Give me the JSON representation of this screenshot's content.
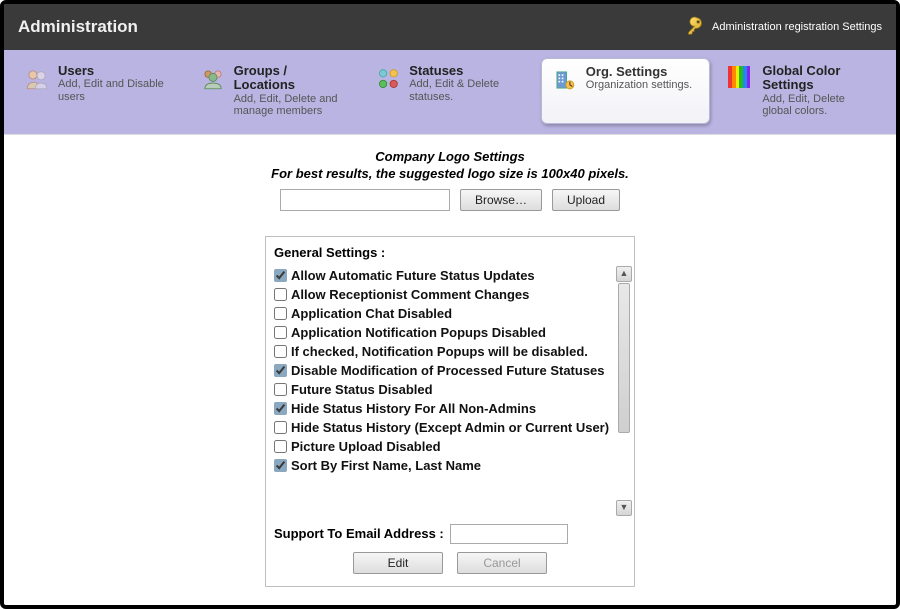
{
  "header": {
    "title": "Administration",
    "right_text": "Administration registration Settings",
    "icon": "key-icon"
  },
  "ribbon": {
    "items": [
      {
        "id": "users",
        "title": "Users",
        "subtitle": "Add, Edit and Disable users"
      },
      {
        "id": "groups",
        "title": "Groups / Locations",
        "subtitle": "Add, Edit, Delete and manage members"
      },
      {
        "id": "statuses",
        "title": "Statuses",
        "subtitle": "Add, Edit & Delete statuses."
      },
      {
        "id": "org",
        "title": "Org. Settings",
        "subtitle": "Organization settings.",
        "active": true
      },
      {
        "id": "colors",
        "title": "Global Color Settings",
        "subtitle": "Add, Edit, Delete global colors."
      }
    ]
  },
  "logo_section": {
    "heading": "Company Logo Settings",
    "subheading": "For best results, the suggested logo size is 100x40 pixels.",
    "browse_label": "Browse…",
    "upload_label": "Upload"
  },
  "panel": {
    "title": "General Settings :",
    "support_label": "Support To Email Address :",
    "support_value": "",
    "edit_label": "Edit",
    "cancel_label": "Cancel",
    "options": [
      {
        "label": "Allow Automatic Future Status Updates",
        "checked": true
      },
      {
        "label": "Allow Receptionist Comment Changes",
        "checked": false
      },
      {
        "label": "Application Chat Disabled",
        "checked": false
      },
      {
        "label": "Application Notification Popups Disabled",
        "checked": false
      },
      {
        "label": "If checked, Notification Popups will be disabled.",
        "checked": false
      },
      {
        "label": "Disable Modification of Processed Future Statuses",
        "checked": true
      },
      {
        "label": "Future Status Disabled",
        "checked": false
      },
      {
        "label": "Hide Status History For All Non-Admins",
        "checked": true
      },
      {
        "label": "Hide Status History (Except Admin or Current User)",
        "checked": false
      },
      {
        "label": "Picture Upload Disabled",
        "checked": false
      },
      {
        "label": "Sort By First Name, Last Name",
        "checked": true
      }
    ]
  }
}
